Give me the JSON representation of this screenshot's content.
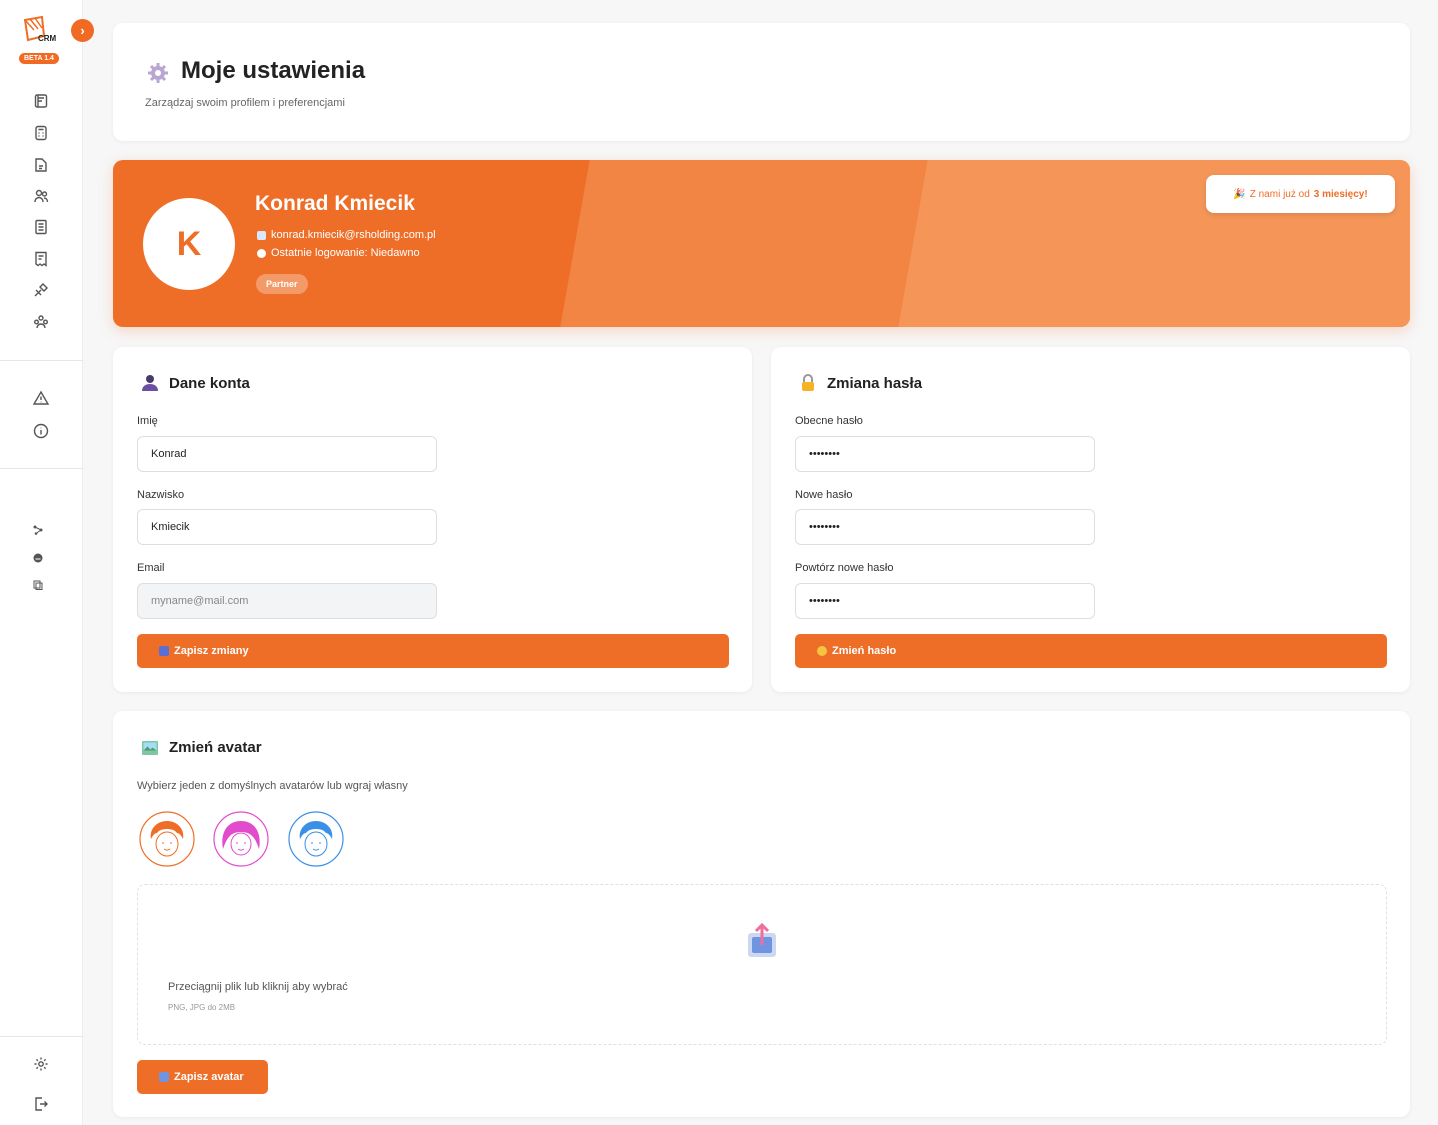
{
  "sidebar": {
    "logo_text": "CRM",
    "beta": "BETA 1.4",
    "toggle": "›",
    "nav_icons": [
      "notebook-icon",
      "calculator-icon",
      "document-icon",
      "users-icon",
      "list-icon",
      "receipt-icon",
      "tools-icon",
      "team-icon",
      "warning-icon",
      "info-icon",
      "share-icon",
      "chat-icon",
      "copy-icon",
      "settings-icon",
      "logout-icon"
    ]
  },
  "header": {
    "title": "Moje ustawienia",
    "subtitle": "Zarządzaj swoim profilem i preferencjami"
  },
  "profile": {
    "initial": "K",
    "name": "Konrad Kmiecik",
    "email": "konrad.kmiecik@rsholding.com.pl",
    "last_login": "Ostatnie logowanie: Niedawno",
    "role": "Partner",
    "since_prefix": "Z nami już od",
    "since_value": "3 miesięcy!"
  },
  "account": {
    "title": "Dane konta",
    "first_name_label": "Imię",
    "first_name_value": "Konrad",
    "last_name_label": "Nazwisko",
    "last_name_value": "Kmiecik",
    "email_label": "Email",
    "email_placeholder": "myname@mail.com",
    "save_label": "Zapisz zmiany"
  },
  "password": {
    "title": "Zmiana hasła",
    "current_label": "Obecne hasło",
    "current_value": "••••••••",
    "new_label": "Nowe hasło",
    "new_value": "••••••••",
    "repeat_label": "Powtórz nowe hasło",
    "repeat_value": "••••••••",
    "change_label": "Zmień hasło"
  },
  "avatar": {
    "title": "Zmień avatar",
    "subtitle": "Wybierz jeden z domyślnych avatarów lub wgraj własny",
    "options": [
      {
        "name": "avatar-orange",
        "color": "#ef6e27"
      },
      {
        "name": "avatar-pink",
        "color": "#e24ccc"
      },
      {
        "name": "avatar-blue",
        "color": "#3a8fe6"
      }
    ],
    "dropzone_text": "Przeciągnij plik lub kliknij aby wybrać",
    "dropzone_hint": "PNG, JPG do 2MB",
    "save_label": "Zapisz avatar"
  },
  "colors": {
    "accent": "#ef6e27"
  }
}
